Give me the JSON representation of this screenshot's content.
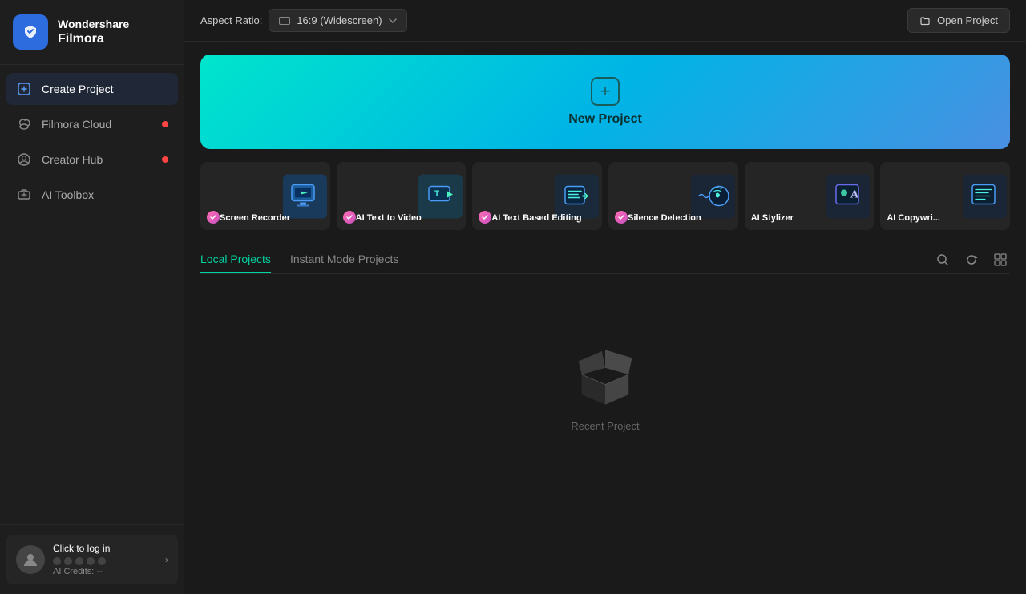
{
  "app": {
    "brand": "Wondershare",
    "product": "Filmora"
  },
  "sidebar": {
    "nav_items": [
      {
        "id": "create-project",
        "label": "Create Project",
        "active": true,
        "dot": false
      },
      {
        "id": "filmora-cloud",
        "label": "Filmora Cloud",
        "active": false,
        "dot": true
      },
      {
        "id": "creator-hub",
        "label": "Creator Hub",
        "active": false,
        "dot": true
      },
      {
        "id": "ai-toolbox",
        "label": "AI Toolbox",
        "active": false,
        "dot": false
      }
    ],
    "user": {
      "click_to_login": "Click to log in",
      "ai_credits_label": "AI Credits: --",
      "avatar_icon": "👤"
    }
  },
  "header": {
    "aspect_ratio_label": "Aspect Ratio:",
    "aspect_ratio_value": "16:9 (Widescreen)",
    "open_project_label": "Open Project"
  },
  "new_project": {
    "label": "New Project"
  },
  "feature_cards": [
    {
      "id": "screen-recorder",
      "label": "Screen Recorder",
      "badge": true
    },
    {
      "id": "ai-text-to-video",
      "label": "AI Text to Video",
      "badge": true
    },
    {
      "id": "ai-text-based-editing",
      "label": "AI Text Based Editing",
      "badge": true
    },
    {
      "id": "silence-detection",
      "label": "Silence Detection",
      "badge": true
    },
    {
      "id": "ai-stylizer",
      "label": "AI Stylizer",
      "badge": false
    },
    {
      "id": "ai-copywriter",
      "label": "AI Copywri...",
      "badge": false
    }
  ],
  "tabs": {
    "local_projects": "Local Projects",
    "instant_mode": "Instant Mode Projects"
  },
  "empty_projects": {
    "label": "Recent Project"
  }
}
